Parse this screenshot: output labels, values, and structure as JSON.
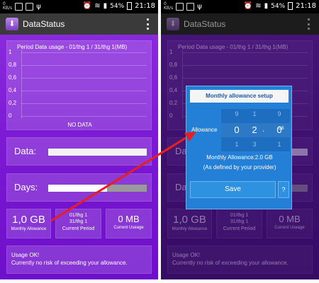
{
  "statusbar": {
    "speed_top": "0",
    "speed_bottom": "KB/s",
    "signal_pct": "54%",
    "time": "21:18"
  },
  "app": {
    "title": "DataStatus"
  },
  "chart": {
    "title": "Period Data usage - 01/thg 1 / 31/thg 1(MB)",
    "y_ticks": [
      "1",
      "0,8",
      "0,6",
      "0,4",
      "0,2",
      "0"
    ],
    "empty_text": "NO DATA"
  },
  "chart_data": {
    "type": "line",
    "title": "Period Data usage - 01/thg 1 / 31/thg 1(MB)",
    "xlabel": "",
    "ylabel": "",
    "ylim": [
      0,
      1
    ],
    "y_ticks": [
      1,
      0.8,
      0.6,
      0.4,
      0.2,
      0
    ],
    "series": [],
    "annotation": "NO DATA",
    "grid": true
  },
  "bars": {
    "data_label": "Data:",
    "data_fraction": 0.0,
    "days_label": "Days:",
    "days_fraction": 0.6
  },
  "boxes": {
    "allowance_value": "1,0 GB",
    "allowance_caption": "Monthly Allowance",
    "period_start": "01/thg 1",
    "period_end": "31/thg 1",
    "period_caption": "Current Period",
    "usage_value": "0 MB",
    "usage_caption": "Current Useage"
  },
  "status": {
    "line1": "Usage OK!",
    "line2": "Currently no risk of exceeding your allowance."
  },
  "dialog": {
    "title": "Monthly allowance setup",
    "picker_label": "Allowance",
    "digit1": {
      "prev": "9",
      "cur": "0",
      "next": "1"
    },
    "digit2": {
      "prev": "1",
      "cur": "2",
      "next": "3"
    },
    "digit3": {
      "prev": "9",
      "cur": "0",
      "next": "1"
    },
    "separator": ".",
    "unit": "GB",
    "info_line1": "Monthly Allowance:2.0 GB",
    "info_line2": "(As defined by your provider)",
    "save_label": "Save",
    "help_label": "?"
  },
  "colors": {
    "panel_purple": "#7a18d2",
    "dialog_blue": "#2380d6",
    "arrow_red": "#e81e1e"
  },
  "icons": {
    "app": "download-icon",
    "overflow": "overflow-menu-icon",
    "wifi": "wifi-icon",
    "signal": "signal-icon",
    "battery": "battery-icon"
  }
}
